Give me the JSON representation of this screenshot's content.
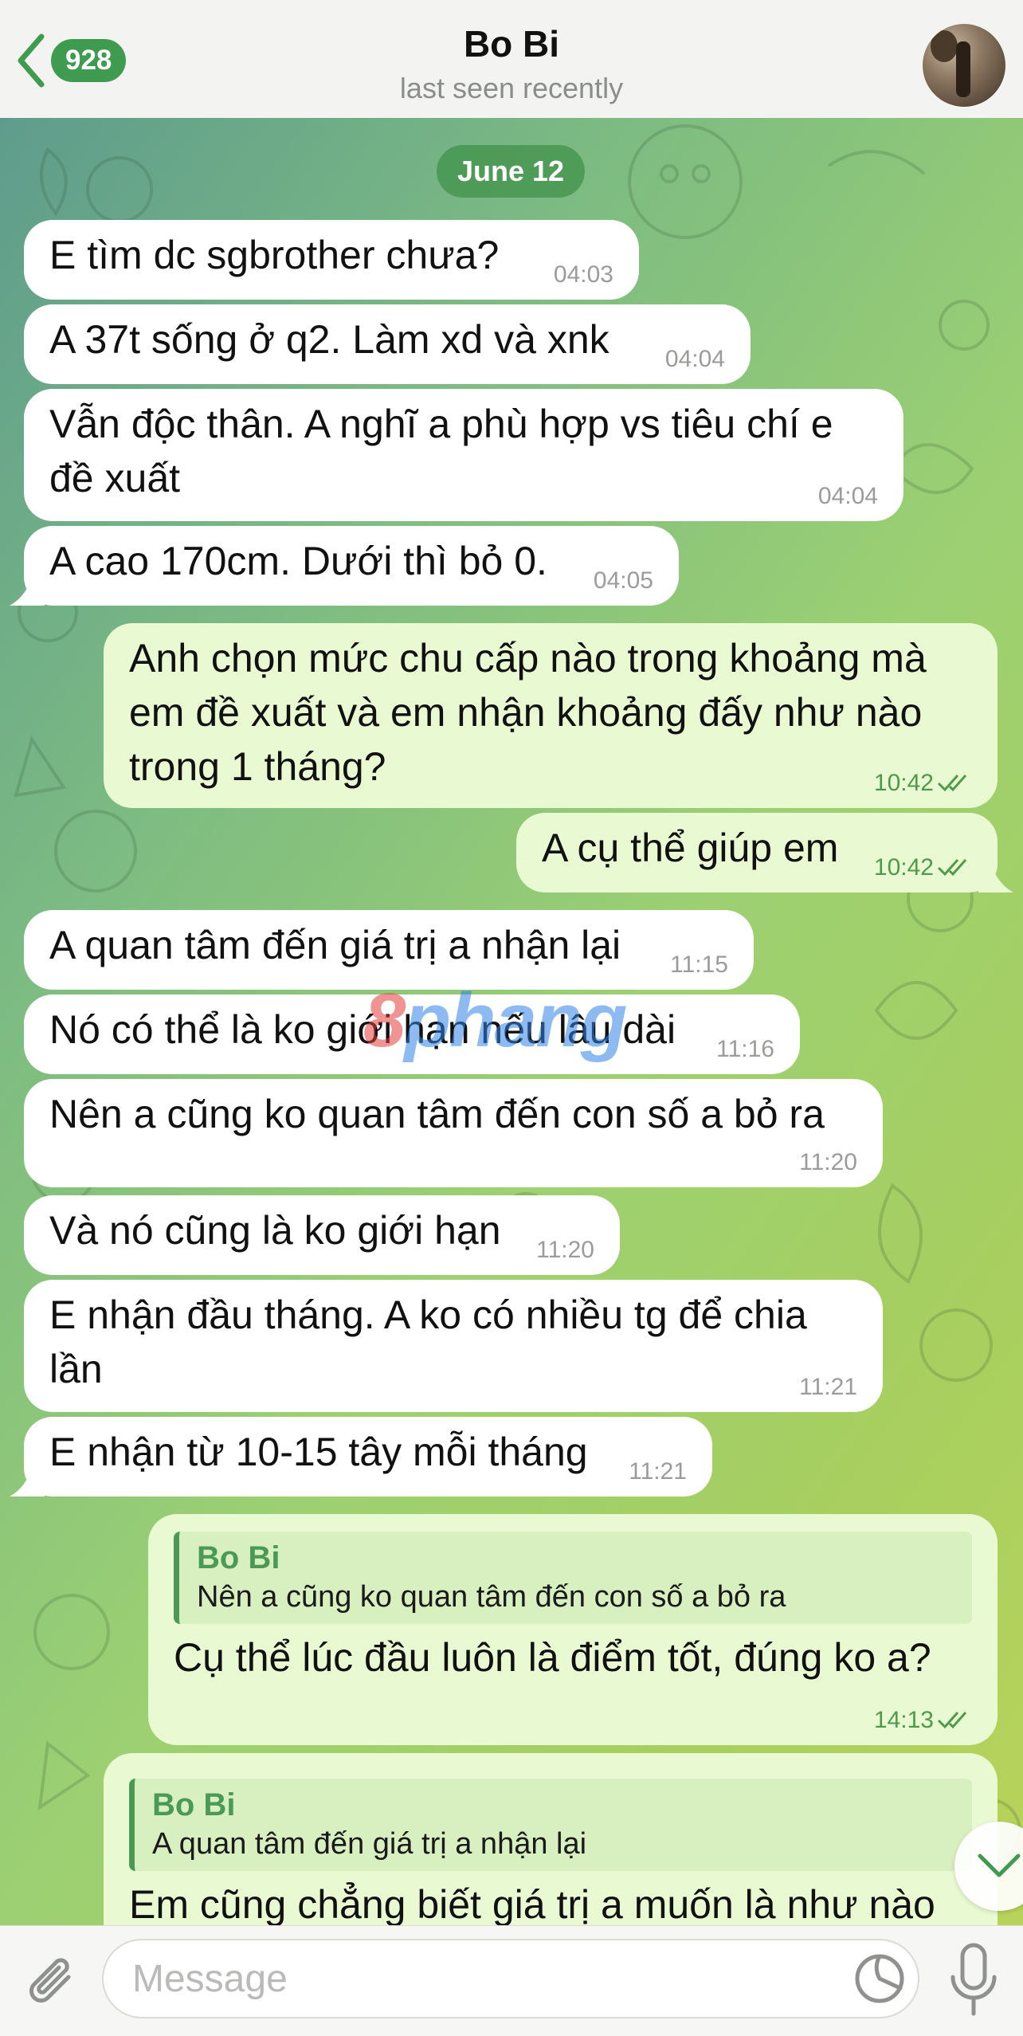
{
  "header": {
    "back_label": "",
    "unread_count": "928",
    "title": "Bo Bi",
    "status": "last seen recently"
  },
  "date_separator": "June 12",
  "messages": [
    {
      "dir": "in",
      "text": "E tìm dc sgbrother chưa?",
      "time": "04:03"
    },
    {
      "dir": "in",
      "text": "A 37t sống ở q2. Làm xd và xnk",
      "time": "04:04"
    },
    {
      "dir": "in",
      "text": "Vẫn độc thân. A nghĩ a phù hợp vs tiêu chí e\nđề xuất",
      "time": "04:04"
    },
    {
      "dir": "in",
      "text": "A cao 170cm. Dưới thì bỏ 0.",
      "time": "04:05"
    },
    {
      "dir": "out",
      "text": "Anh chọn mức chu cấp nào trong khoảng mà\nem đề xuất và em nhận khoảng đấy như nào\ntrong 1 tháng?",
      "time": "10:42"
    },
    {
      "dir": "out",
      "text": "A cụ thể giúp em",
      "time": "10:42"
    },
    {
      "dir": "in",
      "text": "A quan tâm đến giá trị a nhận lại",
      "time": "11:15"
    },
    {
      "dir": "in",
      "text": "Nó có thể là ko giới hạn nếu lâu dài",
      "time": "11:16"
    },
    {
      "dir": "in",
      "text": "Nên a cũng ko quan tâm đến con số a bỏ ra",
      "time": "11:20"
    },
    {
      "dir": "in",
      "text": "Và nó cũng là ko giới hạn",
      "time": "11:20"
    },
    {
      "dir": "in",
      "text": "E nhận đầu tháng. A ko có nhiều tg để chia\nlần",
      "time": "11:21"
    },
    {
      "dir": "in",
      "text": "E nhận từ 10-15 tây mỗi tháng",
      "time": "11:21"
    },
    {
      "dir": "out",
      "reply_name": "Bo Bi",
      "reply_text": "Nên a cũng ko quan tâm đến con số a bỏ ra",
      "text": "Cụ thể lúc đầu luôn là điểm tốt, đúng ko a?",
      "time": "14:13"
    },
    {
      "dir": "out",
      "reply_name": "Bo Bi",
      "reply_text": "A quan tâm đến giá trị a nhận lại",
      "text": "Em cũng chẳng biết giá trị a muốn là như nào",
      "time": ""
    }
  ],
  "watermark": {
    "part1": "8",
    "part2": "phang"
  },
  "input": {
    "placeholder": "Message"
  },
  "icons": {
    "back": "chevron-left-icon",
    "attach": "paperclip-icon",
    "sticker": "sticker-icon",
    "mic": "microphone-icon",
    "scroll_down": "chevron-down-icon"
  },
  "colors": {
    "accent": "#3e9b4f",
    "outgoing_bubble": "#e9fad2",
    "incoming_bubble": "#ffffff"
  }
}
